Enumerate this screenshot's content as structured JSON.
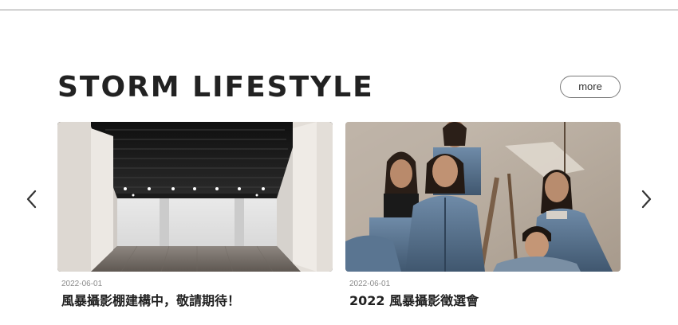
{
  "section": {
    "title": "STORM LIFESTYLE",
    "more_label": "more"
  },
  "carousel": {
    "prev_icon": "chevron-left-icon",
    "next_icon": "chevron-right-icon"
  },
  "cards": [
    {
      "date": "2022-06-01",
      "title": "風暴攝影棚建構中，敬請期待！",
      "image": "studio-interior-photo"
    },
    {
      "date": "2022-06-01",
      "title": "2022 風暴攝影徵選會",
      "image": "denim-group-photo"
    }
  ],
  "colors": {
    "title": "#222222",
    "date": "#8a8a8a",
    "button_border": "#7a7a7a",
    "divider": "#9a9a9a"
  }
}
